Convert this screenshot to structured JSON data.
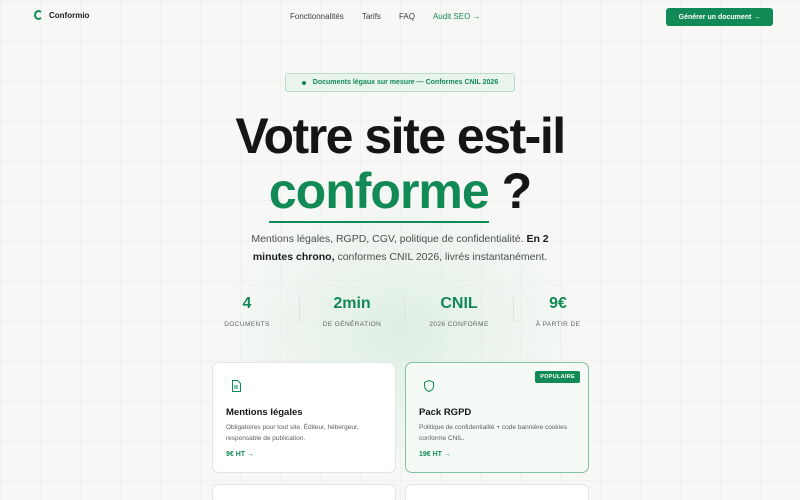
{
  "brand": {
    "name": "Conformio",
    "accent": "#128a55"
  },
  "nav": {
    "links": [
      "Fonctionnalités",
      "Tarifs",
      "FAQ"
    ],
    "seo_link": "Audit SEO →",
    "cta": "Générer un document →"
  },
  "hero": {
    "badge": "Documents légaux sur mesure — Conformes CNIL 2026",
    "title_line1": "Votre site est-il",
    "title_accent": "conforme",
    "title_q": "?",
    "subtitle_a": "Mentions légales, RGPD, CGV, politique de confidentialité.",
    "subtitle_b": "En 2 minutes chrono,",
    "subtitle_c": "conformes CNIL 2026, livrés instantanément."
  },
  "stats": [
    {
      "value": "4",
      "label": "DOCUMENTS"
    },
    {
      "value": "2min",
      "label": "DE GÉNÉRATION"
    },
    {
      "value": "CNIL",
      "label": "2026 CONFORME"
    },
    {
      "value": "9€",
      "label": "À PARTIR DE"
    }
  ],
  "cards": [
    {
      "icon": "document-icon",
      "title": "Mentions légales",
      "desc": "Obligatoires pour tout site. Éditeur, hébergeur, responsable de publication.",
      "price": "9€ HT →"
    },
    {
      "icon": "shield-icon",
      "badge": "POPULAIRE",
      "title": "Pack RGPD",
      "desc": "Politique de confidentialité + code bannière cookies conforme CNIL.",
      "price": "19€ HT →"
    }
  ]
}
